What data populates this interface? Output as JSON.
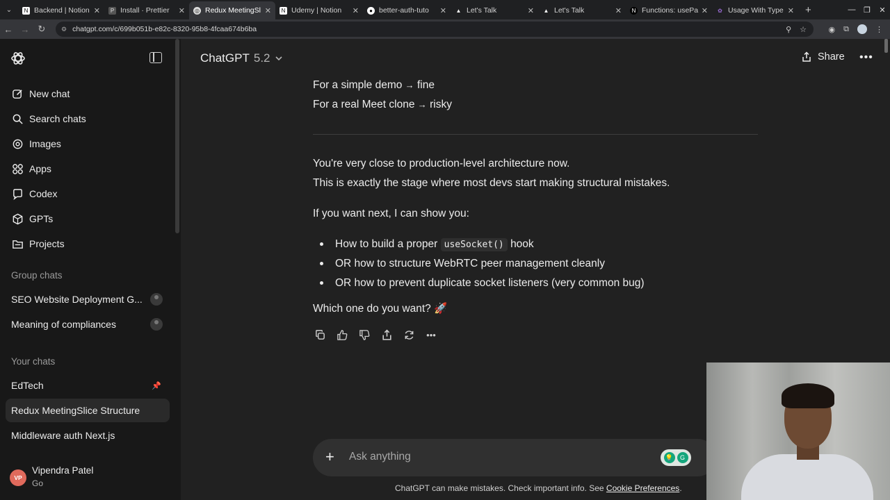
{
  "browser": {
    "tabs": [
      {
        "title": "Backend | Notion",
        "favicon": "notion-icon",
        "active": false
      },
      {
        "title": "Install · Prettier",
        "favicon": "prettier-icon",
        "active": false
      },
      {
        "title": "Redux MeetingSl",
        "favicon": "chatgpt-icon",
        "active": true
      },
      {
        "title": "Udemy | Notion",
        "favicon": "notion-icon",
        "active": false
      },
      {
        "title": "better-auth-tuto",
        "favicon": "github-icon",
        "active": false
      },
      {
        "title": "Let's Talk",
        "favicon": "vercel-icon",
        "active": false
      },
      {
        "title": "Let's Talk",
        "favicon": "vercel-icon",
        "active": false
      },
      {
        "title": "Functions: usePa",
        "favicon": "nextjs-icon",
        "active": false
      },
      {
        "title": "Usage With Type",
        "favicon": "redux-icon",
        "active": false
      }
    ],
    "url": "chatgpt.com/c/699b051b-e82c-8320-95b8-4fcaa674b6ba"
  },
  "sidebar": {
    "nav": [
      {
        "label": "New chat",
        "icon": "edit-icon"
      },
      {
        "label": "Search chats",
        "icon": "search-icon"
      },
      {
        "label": "Images",
        "icon": "image-icon"
      },
      {
        "label": "Apps",
        "icon": "apps-icon"
      },
      {
        "label": "Codex",
        "icon": "codex-icon"
      },
      {
        "label": "GPTs",
        "icon": "gpts-icon"
      },
      {
        "label": "Projects",
        "icon": "folder-icon"
      }
    ],
    "group_chats_label": "Group chats",
    "group_chats": [
      "SEO Website Deployment G...",
      "Meaning of compliances"
    ],
    "your_chats_label": "Your chats",
    "your_chats": [
      "EdTech",
      "Redux MeetingSlice Structure",
      "Middleware auth Next.js"
    ],
    "user": {
      "initials": "VP",
      "name": "Vipendra Patel",
      "plan": "Go"
    }
  },
  "header": {
    "model_name": "ChatGPT",
    "model_version": "5.2",
    "share_label": "Share"
  },
  "message": {
    "line1_pre": "For a simple demo",
    "line1_arrow": "→",
    "line1_post": "fine",
    "line2_pre": "For a real Meet clone",
    "line2_arrow": "→",
    "line2_post": "risky",
    "para1_a": "You're very close to production-level architecture now.",
    "para1_b": "This is exactly the stage where most devs start making structural mistakes.",
    "intro": "If you want next, I can show you:",
    "bullet1_pre": "How to build a proper",
    "bullet1_code": "useSocket()",
    "bullet1_post": "hook",
    "bullet2": "OR how to structure WebRTC peer management cleanly",
    "bullet3": "OR how to prevent duplicate socket listeners (very common bug)",
    "question": "Which one do you want?",
    "emoji": "🚀"
  },
  "composer": {
    "placeholder": "Ask anything"
  },
  "footer": {
    "note": "ChatGPT can make mistakes. Check important info. See",
    "link": "Cookie Preferences",
    "end": "."
  }
}
